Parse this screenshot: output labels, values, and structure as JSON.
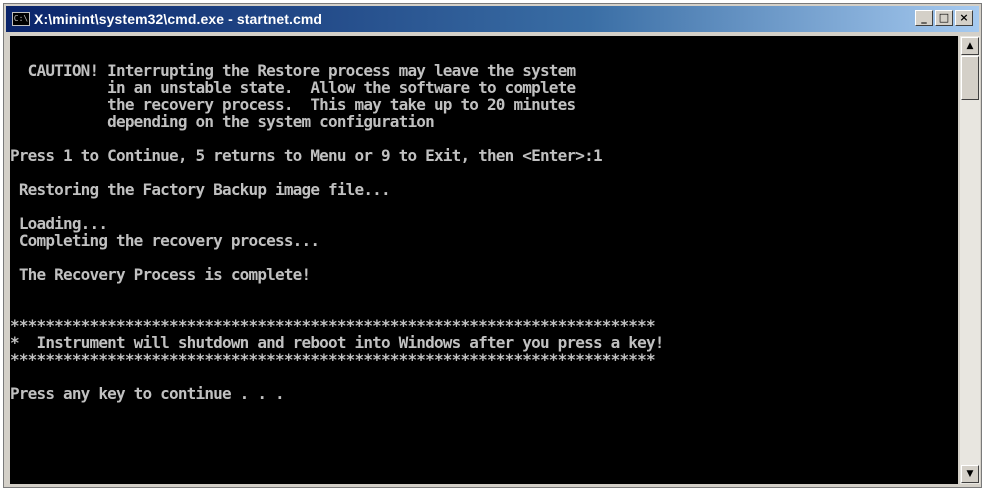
{
  "window": {
    "title": "X:\\minint\\system32\\cmd.exe - startnet.cmd",
    "icon": "cmd-icon",
    "icon_glyph": "C:\\",
    "buttons": {
      "minimize": "_",
      "maximize": "□",
      "close": "×"
    }
  },
  "console": {
    "text_color": "#c0c0c0",
    "background": "#000000",
    "lines": [
      "  CAUTION! Interrupting the Restore process may leave the system",
      "           in an unstable state.  Allow the software to complete",
      "           the recovery process.  This may take up to 20 minutes",
      "           depending on the system configuration",
      "",
      "Press 1 to Continue, 5 returns to Menu or 9 to Exit, then <Enter>:1",
      "",
      " Restoring the Factory Backup image file...",
      "",
      " Loading...",
      " Completing the recovery process...",
      "",
      " The Recovery Process is complete!",
      "",
      "",
      "*************************************************************************",
      "*  Instrument will shutdown and reboot into Windows after you press a key!",
      "*************************************************************************",
      "",
      "Press any key to continue . . ."
    ]
  },
  "scrollbar": {
    "up_arrow": "▲",
    "down_arrow": "▼"
  }
}
